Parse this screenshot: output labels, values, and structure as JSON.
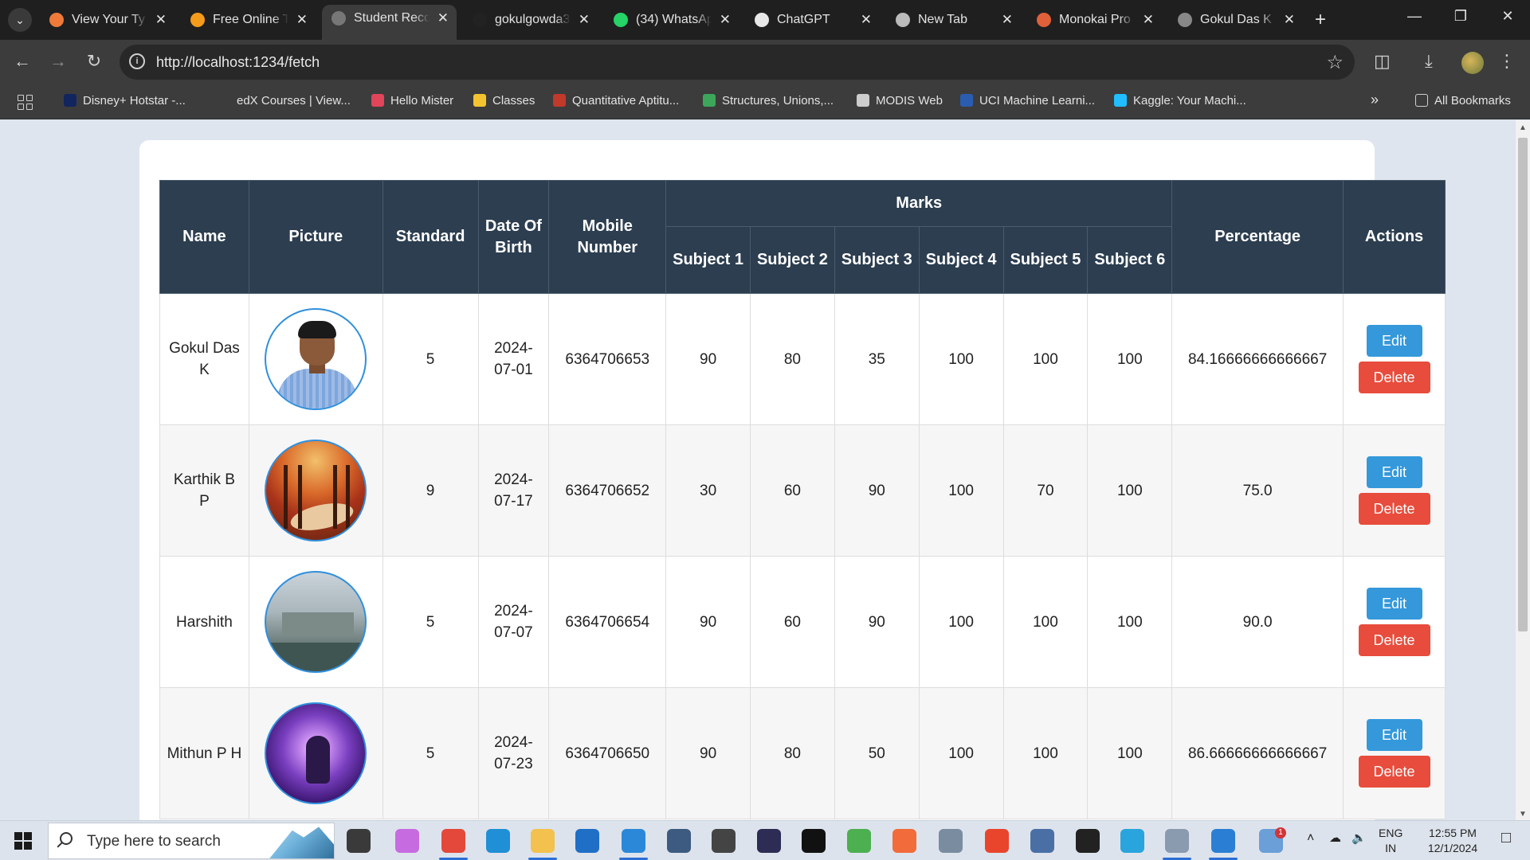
{
  "browser": {
    "tabs": [
      {
        "title": "View Your Ty",
        "color": "#f07a3a",
        "active": false
      },
      {
        "title": "Free Online T",
        "color": "#f59b1b",
        "active": false
      },
      {
        "title": "Student Reco",
        "color": "#777777",
        "active": true
      },
      {
        "title": "gokulgowda3",
        "color": "#222222",
        "active": false
      },
      {
        "title": "(34) WhatsAp",
        "color": "#25d366",
        "active": false
      },
      {
        "title": "ChatGPT",
        "color": "#e8e8e8",
        "active": false
      },
      {
        "title": "New Tab",
        "color": "#bbbbbb",
        "active": false
      },
      {
        "title": "Monokai Pro",
        "color": "#e0603a",
        "active": false
      },
      {
        "title": "Gokul Das K",
        "color": "#888888",
        "active": false
      }
    ],
    "url": "http://localhost:1234/fetch",
    "bookmarks": [
      {
        "label": "Disney+ Hotstar -...",
        "color": "#13255e"
      },
      {
        "label": "edX Courses | View...",
        "color": "#3c3c3c"
      },
      {
        "label": "Hello Mister",
        "color": "#e0455a"
      },
      {
        "label": "Classes",
        "color": "#f4c430"
      },
      {
        "label": "Quantitative Aptitu...",
        "color": "#c0392b"
      },
      {
        "label": "Structures, Unions,...",
        "color": "#3ca65b"
      },
      {
        "label": "MODIS Web",
        "color": "#cccccc"
      },
      {
        "label": "UCI Machine Learni...",
        "color": "#2a5db0"
      },
      {
        "label": "Kaggle: Your Machi...",
        "color": "#20beff"
      }
    ],
    "all_bookmarks": "All Bookmarks"
  },
  "table": {
    "headers": {
      "name": "Name",
      "picture": "Picture",
      "standard": "Standard",
      "dob": "Date Of Birth",
      "mobile": "Mobile Number",
      "marks": "Marks",
      "subjects": [
        "Subject 1",
        "Subject 2",
        "Subject 3",
        "Subject 4",
        "Subject 5",
        "Subject 6"
      ],
      "percentage": "Percentage",
      "actions": "Actions"
    },
    "rows": [
      {
        "name": "Gokul Das K",
        "picture": "person-photo",
        "standard": "5",
        "dob": "2024-07-01",
        "mobile": "6364706653",
        "marks": [
          "90",
          "80",
          "35",
          "100",
          "100",
          "100"
        ],
        "percentage": "84.16666666666667"
      },
      {
        "name": "Karthik B P",
        "picture": "autumn-forest-photo",
        "standard": "9",
        "dob": "2024-07-17",
        "mobile": "6364706652",
        "marks": [
          "30",
          "60",
          "90",
          "100",
          "70",
          "100"
        ],
        "percentage": "75.0"
      },
      {
        "name": "Harshith",
        "picture": "misty-town-photo",
        "standard": "5",
        "dob": "2024-07-07",
        "mobile": "6364706654",
        "marks": [
          "90",
          "60",
          "90",
          "100",
          "100",
          "100"
        ],
        "percentage": "90.0"
      },
      {
        "name": "Mithun P H",
        "picture": "purple-fantasy-photo",
        "standard": "5",
        "dob": "2024-07-23",
        "mobile": "6364706650",
        "marks": [
          "90",
          "80",
          "50",
          "100",
          "100",
          "100"
        ],
        "percentage": "86.66666666666667"
      }
    ],
    "edit_label": "Edit",
    "delete_label": "Delete"
  },
  "taskbar": {
    "search_placeholder": "Type here to search",
    "language": "ENG",
    "region": "IN",
    "time": "12:55 PM",
    "date": "12/1/2024",
    "notification_count": "1"
  }
}
